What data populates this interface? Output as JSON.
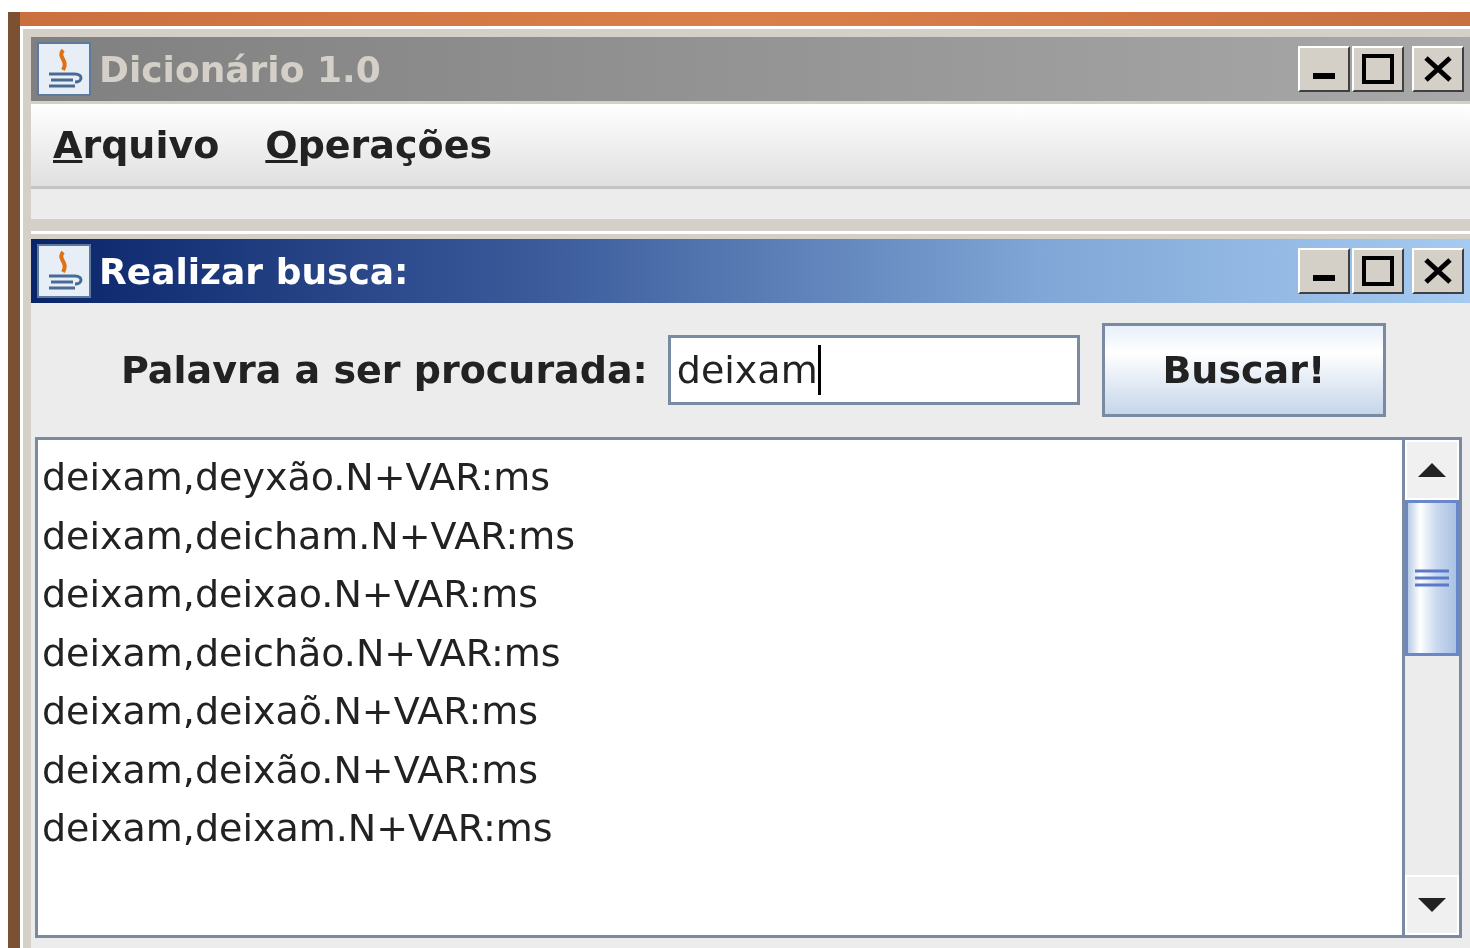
{
  "window": {
    "title": "Dicionário 1.0",
    "active": false
  },
  "menu": [
    {
      "label": "Arquivo"
    },
    {
      "label": "Operações"
    }
  ],
  "internal_frame": {
    "title": "Realizar busca:",
    "active": true
  },
  "search": {
    "label": "Palavra a ser procurada:",
    "value": "deixam",
    "button": "Buscar!"
  },
  "results": [
    "deixam,deyxão.N+VAR:ms",
    "deixam,deicham.N+VAR:ms",
    "deixam,deixao.N+VAR:ms",
    "deixam,deichão.N+VAR:ms",
    "deixam,deixaõ.N+VAR:ms",
    "deixam,deixão.N+VAR:ms",
    "deixam,deixam.N+VAR:ms"
  ]
}
